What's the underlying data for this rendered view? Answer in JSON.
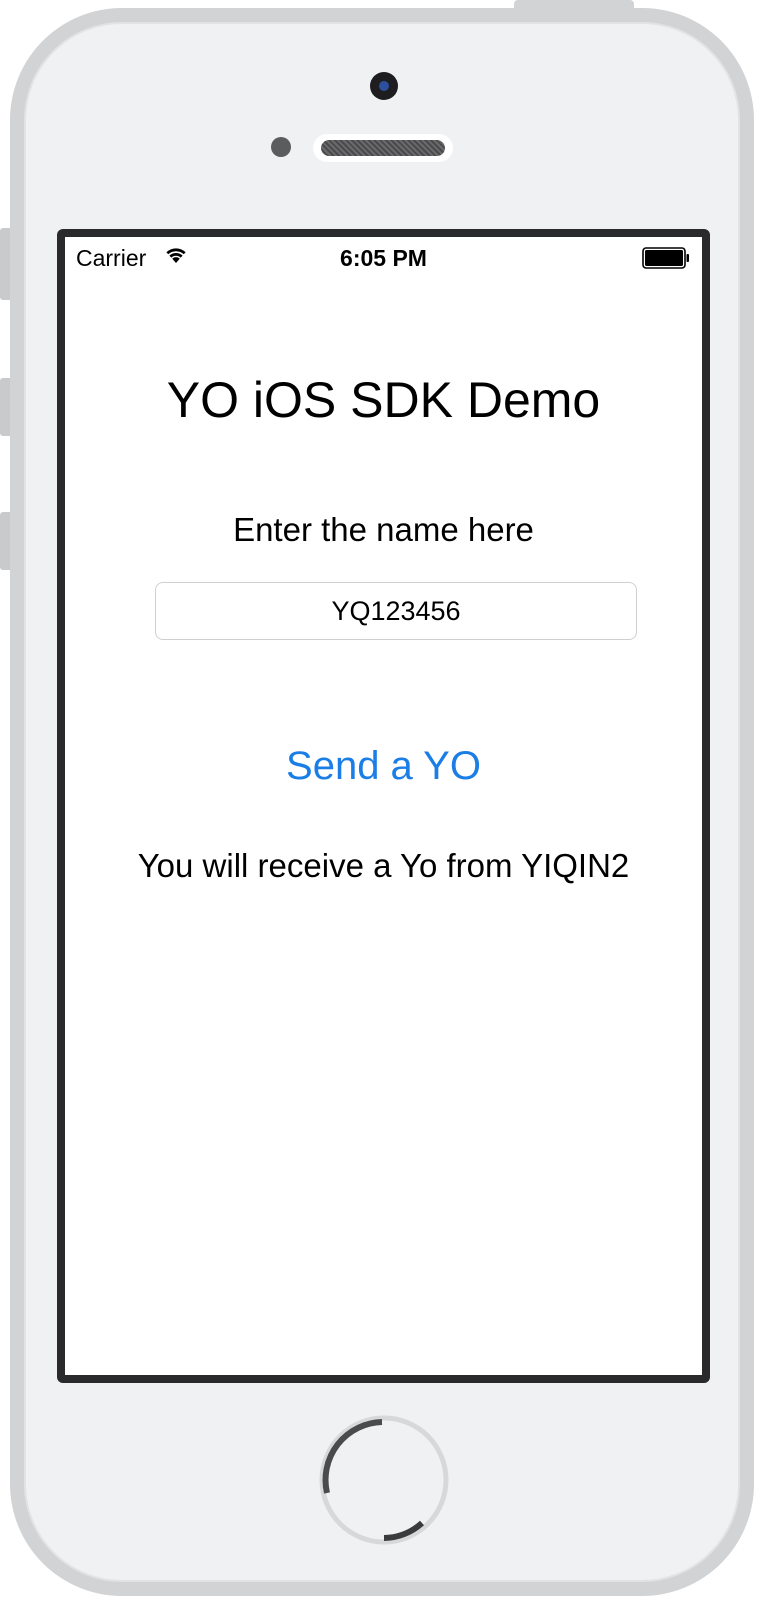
{
  "status_bar": {
    "carrier": "Carrier",
    "time": "6:05 PM",
    "icons": [
      "wifi-icon",
      "battery-icon"
    ]
  },
  "app": {
    "title": "YO iOS SDK Demo",
    "prompt": "Enter the name here",
    "name_input": {
      "value": "YQ123456",
      "placeholder": ""
    },
    "send_label": "Send a YO",
    "result_text": "You will receive a Yo from YIQIN2"
  },
  "colors": {
    "accent": "#1a7ee6",
    "device_frame": "#d2d3d5",
    "device_face": "#f0f1f3",
    "screen_bezel": "#2a2a2c"
  }
}
